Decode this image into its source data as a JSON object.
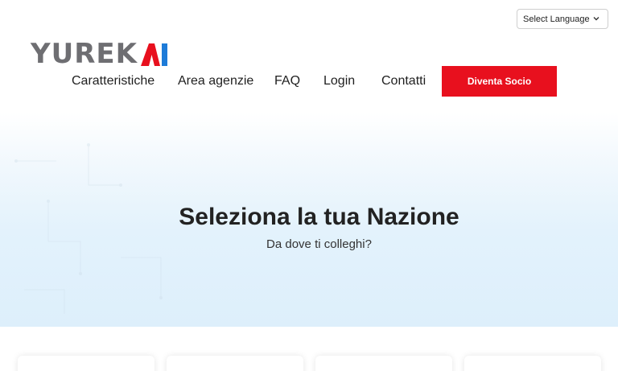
{
  "language_selector": {
    "label": "Select Language",
    "icon": "chevron-down-icon"
  },
  "brand": {
    "logo_text": "YUREKAI",
    "logo_prefix": "YUREK",
    "logo_suffix": "AI",
    "accent_red": "#e8101e",
    "accent_blue": "#1d7bd8",
    "logo_grey": "#6e6e72"
  },
  "nav": {
    "items": [
      {
        "label": "Caratteristiche"
      },
      {
        "label": "Area agenzie"
      },
      {
        "label": "FAQ"
      },
      {
        "label": "Login"
      },
      {
        "label": "Contatti"
      }
    ],
    "cta_label": "Diventa Socio"
  },
  "hero": {
    "title": "Seleziona la tua Nazione",
    "subtitle": "Da dove ti colleghi?"
  }
}
